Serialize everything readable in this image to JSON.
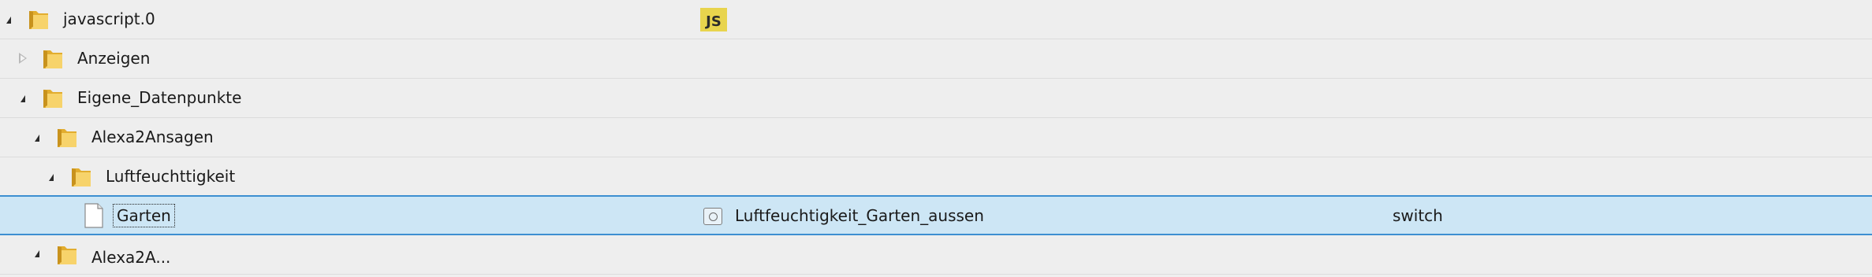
{
  "rows": [
    {
      "name": "javascript.0",
      "badge": "JS"
    },
    {
      "name": "Anzeigen"
    },
    {
      "name": "Eigene_Datenpunkte"
    },
    {
      "name": "Alexa2Ansagen"
    },
    {
      "name": "Luftfeuchttigkeit"
    },
    {
      "name": "Garten",
      "object_name": "Luftfeuchtigkeit_Garten_aussen",
      "role": "switch"
    },
    {
      "name": "Alexa2A..."
    }
  ],
  "colors": {
    "selection": "#cde6f5",
    "selection_border": "#3d8fd1",
    "js_badge": "#e8d44d",
    "folder": "#f3c64a"
  },
  "icons": {
    "folder": "folder-icon",
    "file": "file-icon",
    "js": "javascript-adapter-icon",
    "state": "state-object-icon",
    "expanded": "expanded-triangle-icon",
    "collapsed": "collapsed-triangle-icon"
  }
}
